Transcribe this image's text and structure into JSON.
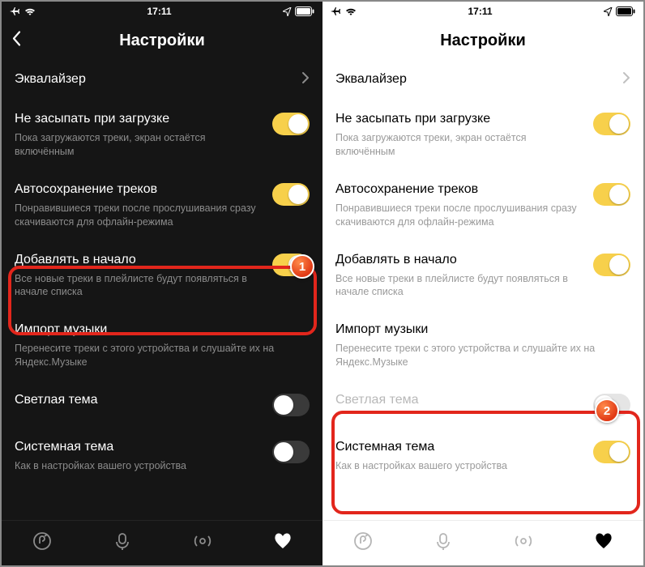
{
  "status": {
    "time": "17:11"
  },
  "header": {
    "title": "Настройки"
  },
  "rows": {
    "equalizer": {
      "label": "Эквалайзер"
    },
    "nosleep": {
      "label": "Не засыпать при загрузке",
      "sub": "Пока загружаются треки, экран остаётся включённым"
    },
    "autosave": {
      "label": "Автосохранение треков",
      "sub": "Понравившиеся треки после прослушивания сразу скачиваются для офлайн-режима"
    },
    "addtop": {
      "label": "Добавлять в начало",
      "sub": "Все новые треки в плейлисте будут появляться в начале списка"
    },
    "import": {
      "label": "Импорт музыки",
      "sub": "Перенесите треки с этого устройства и слушайте их на Яндекс.Музыке"
    },
    "lighttheme": {
      "label": "Светлая тема"
    },
    "systemtheme": {
      "label": "Системная тема",
      "sub": "Как в настройках вашего устройства"
    }
  },
  "badges": {
    "one": "1",
    "two": "2"
  },
  "toggles": {
    "left": {
      "nosleep": true,
      "autosave": true,
      "addtop": true,
      "lighttheme": false,
      "systemtheme": false
    },
    "right": {
      "nosleep": true,
      "autosave": true,
      "addtop": true,
      "lighttheme": false,
      "systemtheme": true
    }
  },
  "colors": {
    "accent": "#f7d04b",
    "highlight": "#e2261c"
  }
}
